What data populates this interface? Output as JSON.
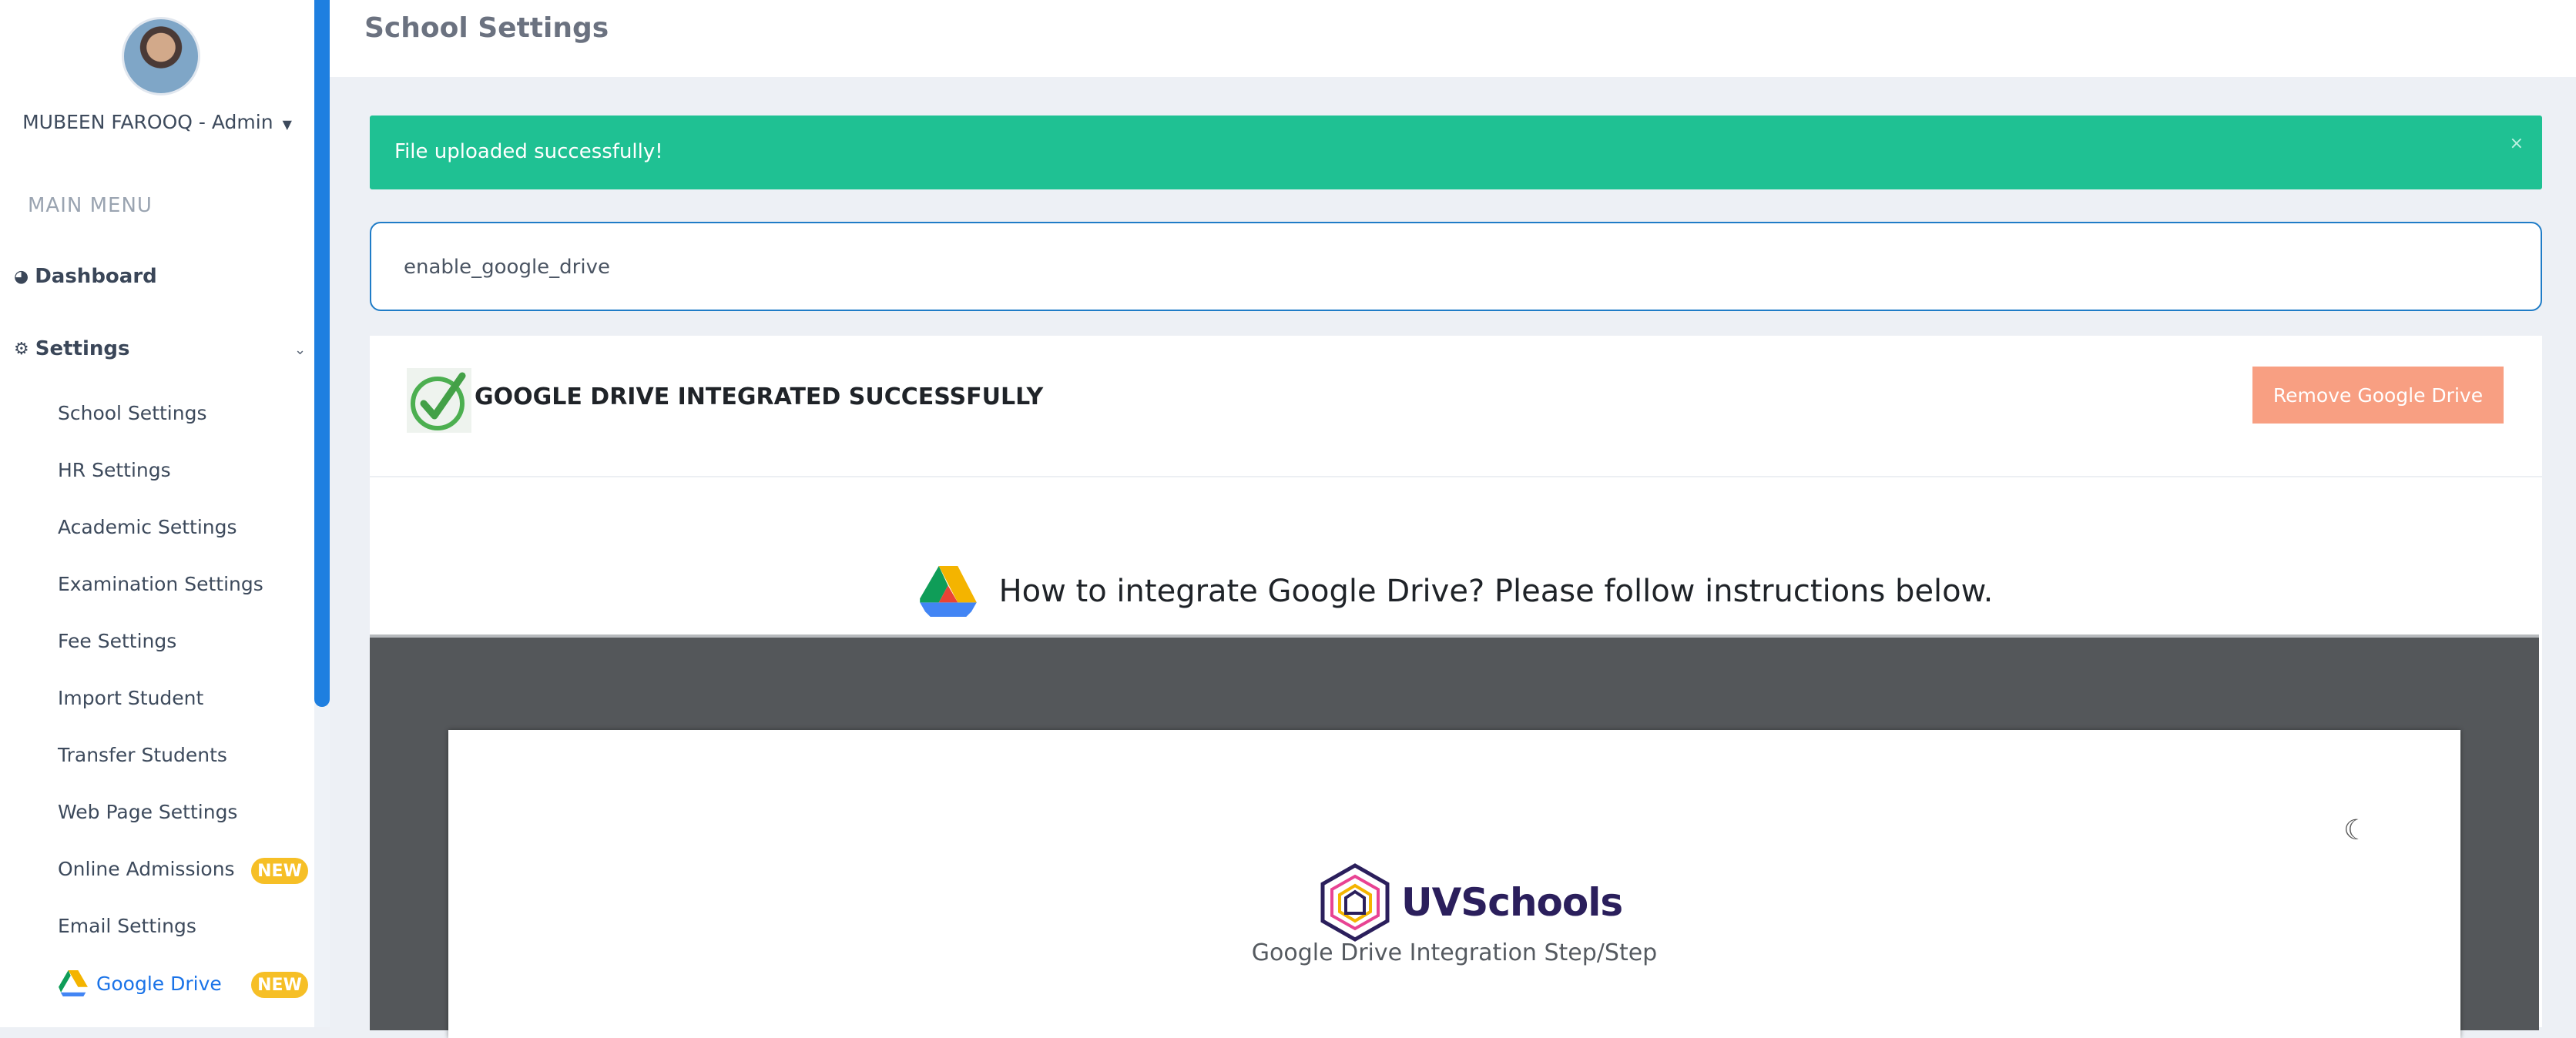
{
  "sidebar": {
    "user_name": "MUBEEN FAROOQ - Admin",
    "menu_heading": "MAIN MENU",
    "dashboard_label": "Dashboard",
    "settings_label": "Settings",
    "items": [
      {
        "label": "School Settings"
      },
      {
        "label": "HR Settings"
      },
      {
        "label": "Academic Settings"
      },
      {
        "label": "Examination Settings"
      },
      {
        "label": "Fee Settings"
      },
      {
        "label": "Import Student"
      },
      {
        "label": "Transfer Students"
      },
      {
        "label": "Web Page Settings"
      },
      {
        "label": "Online Admissions",
        "badge": "NEW"
      },
      {
        "label": "Email Settings"
      },
      {
        "label": "Google Drive",
        "badge": "NEW",
        "active": true
      }
    ]
  },
  "header": {
    "title": "School Settings"
  },
  "alert": {
    "message": "File uploaded successfully!",
    "close": "×"
  },
  "field": {
    "value": "enable_google_drive"
  },
  "status": {
    "text": "GOOGLE DRIVE INTEGRATED SUCCESSFULLY",
    "button_label": "Remove Google Drive"
  },
  "howto": {
    "text": "How to integrate Google Drive? Please follow instructions below."
  },
  "document": {
    "logo_text": "UVSchools",
    "subtitle": "Google Drive Integration Step/Step"
  },
  "colors": {
    "accent": "#1e7fe0",
    "success": "#1fc193",
    "remove": "#f89f82",
    "badge": "#f6bf26",
    "active_link": "#1a73e8"
  }
}
